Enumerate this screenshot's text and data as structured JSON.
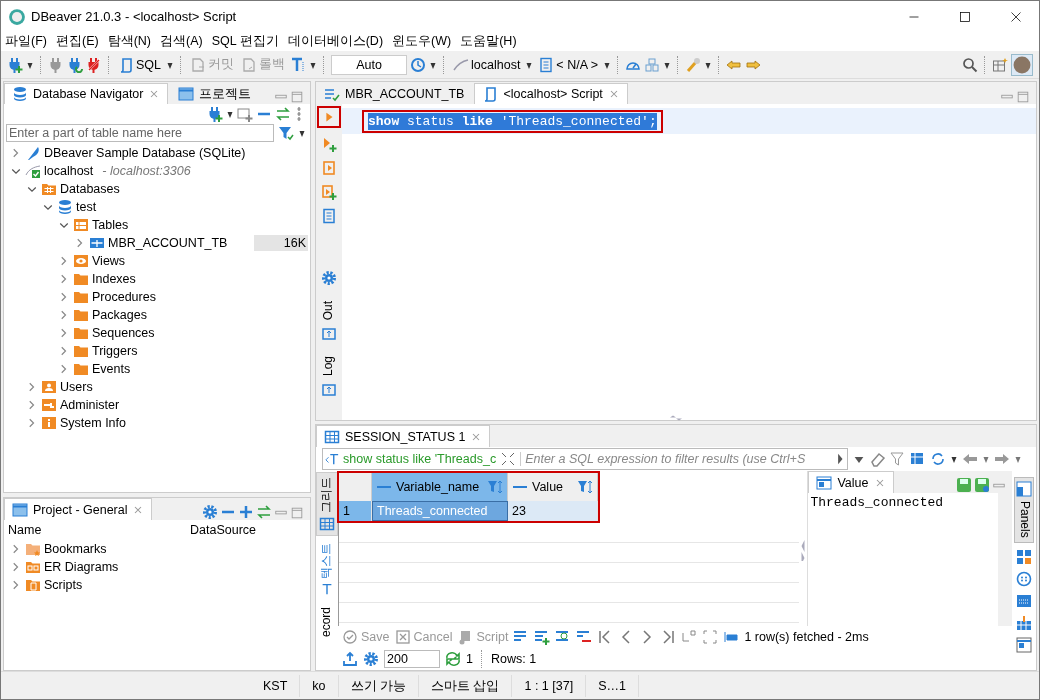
{
  "window": {
    "title": "DBeaver 21.0.3 - <localhost> Script"
  },
  "menu": [
    "파일(F)",
    "편집(E)",
    "탐색(N)",
    "검색(A)",
    "SQL 편집기",
    "데이터베이스(D)",
    "윈도우(W)",
    "도움말(H)"
  ],
  "toolbar": {
    "buttons": [
      {
        "label": "SQL",
        "kind": "sql",
        "disabled": false
      },
      {
        "label": "커밋",
        "kind": "commit",
        "disabled": true
      },
      {
        "label": "롤백",
        "kind": "rollback",
        "disabled": true
      }
    ],
    "transaction_mode": "Auto",
    "connection": "localhost",
    "schema": "< N/A >"
  },
  "navigator": {
    "tabs": [
      {
        "label": "Database Navigator",
        "kind": "database",
        "selected": true
      },
      {
        "label": "프로젝트",
        "kind": "window",
        "selected": false
      }
    ],
    "filter_placeholder": "Enter a part of table name here",
    "tree": [
      {
        "label": "DBeaver Sample Database (SQLite)",
        "kind": "sqlite",
        "expanded": false
      },
      {
        "label": "localhost",
        "detail": "- localhost:3306",
        "kind": "connection",
        "expanded": true,
        "children": [
          {
            "label": "Databases",
            "kind": "databases",
            "expanded": true,
            "children": [
              {
                "label": "test",
                "kind": "database",
                "expanded": true,
                "children": [
                  {
                    "label": "Tables",
                    "kind": "tables",
                    "expanded": true,
                    "children": [
                      {
                        "label": "MBR_ACCOUNT_TB",
                        "kind": "table",
                        "expanded": false,
                        "size": "16K"
                      }
                    ]
                  },
                  {
                    "label": "Views",
                    "kind": "views",
                    "expanded": false
                  },
                  {
                    "label": "Indexes",
                    "kind": "folder",
                    "expanded": false
                  },
                  {
                    "label": "Procedures",
                    "kind": "folder",
                    "expanded": false
                  },
                  {
                    "label": "Packages",
                    "kind": "folder",
                    "expanded": false
                  },
                  {
                    "label": "Sequences",
                    "kind": "folder",
                    "expanded": false
                  },
                  {
                    "label": "Triggers",
                    "kind": "folder",
                    "expanded": false
                  },
                  {
                    "label": "Events",
                    "kind": "folder",
                    "expanded": false
                  }
                ]
              }
            ]
          },
          {
            "label": "Users",
            "kind": "users",
            "expanded": false
          },
          {
            "label": "Administer",
            "kind": "admin",
            "expanded": false
          },
          {
            "label": "System Info",
            "kind": "info",
            "expanded": false
          }
        ]
      }
    ]
  },
  "project": {
    "tab": "Project - General",
    "columns": [
      "Name",
      "DataSource"
    ],
    "items": [
      {
        "label": "Bookmarks",
        "kind": "bookmarks",
        "expanded": false
      },
      {
        "label": "ER Diagrams",
        "kind": "diagrams",
        "expanded": false
      },
      {
        "label": "Scripts",
        "kind": "scripts",
        "expanded": false
      }
    ]
  },
  "editor": {
    "tabs": [
      {
        "label": "MBR_ACCOUNT_TB",
        "kind": "table",
        "selected": false
      },
      {
        "label": "<localhost> Script",
        "kind": "script",
        "selected": true
      }
    ],
    "run_annotated": true,
    "side_tabs": [
      "Out",
      "Log"
    ],
    "lines": [
      {
        "text": "**show** status **like** 'Threads_connected';",
        "selected": true,
        "annotated": true
      }
    ]
  },
  "results": {
    "tab": "SESSION_STATUS 1",
    "query": "show status like 'Threads_c",
    "filter_placeholder": "Enter a SQL expression to filter results (use Ctrl+S",
    "view_tabs": [
      {
        "label": "그리드",
        "selected": true
      },
      {
        "label": "텍스트",
        "selected": false
      },
      {
        "label": "ecord",
        "selected": false
      }
    ],
    "annotated": true,
    "columns": [
      "Variable_name",
      "Value"
    ],
    "rows": [
      {
        "number": "1",
        "cells": [
          "Threads_connected",
          "23"
        ],
        "selected": true
      }
    ],
    "value_panel": {
      "tab": "Value",
      "text": "Threads_connected"
    },
    "panels_tab": "Panels",
    "actions": [
      {
        "label": "Save",
        "kind": "save",
        "disabled": true
      },
      {
        "label": "Cancel",
        "kind": "cancel",
        "disabled": true
      },
      {
        "label": "Script",
        "kind": "script",
        "disabled": true
      }
    ],
    "fetch_status": "1 row(s) fetched - 2ms",
    "fetch_size": "200",
    "refresh_count": "1",
    "rows_count": "Rows: 1"
  },
  "status_bar": [
    "KST",
    "ko",
    "쓰기 가능",
    "스마트 삽입",
    "1 : 1 [37]",
    "S…1"
  ]
}
